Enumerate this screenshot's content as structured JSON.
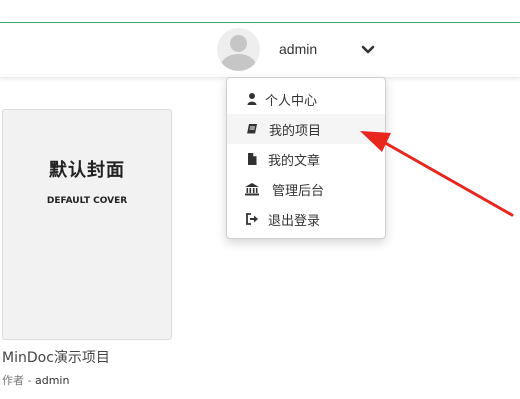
{
  "header": {
    "username": "admin",
    "avatar_icon": "user-avatar-icon",
    "caret_icon": "chevron-down-icon",
    "accent_color": "#3fae6a"
  },
  "dropdown": {
    "items": [
      {
        "label": "个人中心",
        "icon": "user-icon",
        "active": false
      },
      {
        "label": "我的项目",
        "icon": "book-icon",
        "active": true
      },
      {
        "label": "我的文章",
        "icon": "file-icon",
        "active": false
      },
      {
        "label": "管理后台",
        "icon": "bank-icon",
        "active": false
      },
      {
        "label": "退出登录",
        "icon": "sign-out-icon",
        "active": false
      }
    ]
  },
  "project": {
    "cover_title": "默认封面",
    "cover_subtitle": "DEFAULT COVER",
    "name": "MinDoc演示项目",
    "author_label": "作者",
    "author_sep": " - ",
    "author_name": "admin"
  },
  "annotation": {
    "color": "#e8261d"
  }
}
